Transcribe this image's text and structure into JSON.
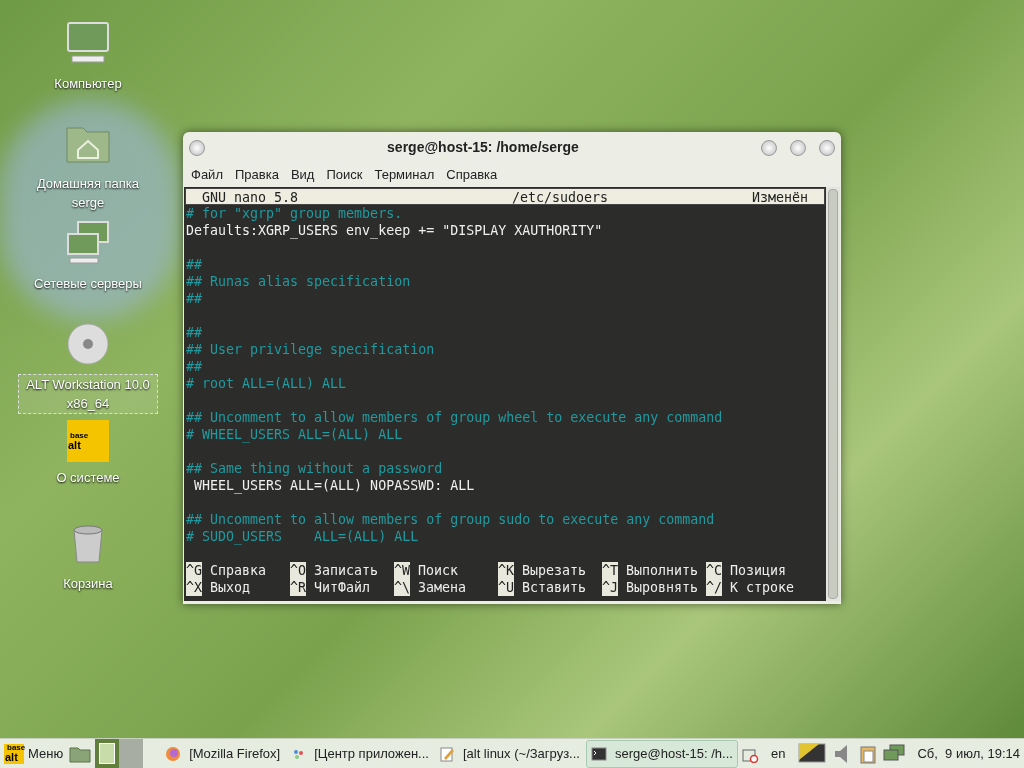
{
  "desktop_icons": [
    {
      "kind": "computer",
      "label": "Компьютер",
      "selected": false
    },
    {
      "kind": "home",
      "label": "Домашняя папка serge",
      "selected": false
    },
    {
      "kind": "network",
      "label": "Сетевые серверы",
      "selected": false
    },
    {
      "kind": "disc",
      "label": "ALT Workstation 10.0 x86_64",
      "selected": true
    },
    {
      "kind": "altlogo",
      "label": "О системе",
      "selected": false,
      "logo": {
        "top": "base",
        "bottom": "alt"
      }
    },
    {
      "kind": "trash",
      "label": "Корзина",
      "selected": false
    }
  ],
  "window": {
    "title": "serge@host-15: /home/serge",
    "menu": [
      "Файл",
      "Правка",
      "Вид",
      "Поиск",
      "Терминал",
      "Справка"
    ]
  },
  "nano": {
    "header": {
      "version": "GNU nano 5.8",
      "file": "/etc/sudoers",
      "status": "Изменён"
    },
    "lines": [
      {
        "kind": "comment",
        "text": "# for \"xgrp\" group members."
      },
      {
        "kind": "code",
        "text": "Defaults:XGRP_USERS env_keep += \"DISPLAY XAUTHORITY\""
      },
      {
        "kind": "blank"
      },
      {
        "kind": "comment",
        "text": "##"
      },
      {
        "kind": "comment",
        "text": "## Runas alias specification"
      },
      {
        "kind": "comment",
        "text": "##"
      },
      {
        "kind": "blank"
      },
      {
        "kind": "comment",
        "text": "##"
      },
      {
        "kind": "comment",
        "text": "## User privilege specification"
      },
      {
        "kind": "comment",
        "text": "##"
      },
      {
        "kind": "comment",
        "text": "# root ALL=(ALL) ALL"
      },
      {
        "kind": "blank"
      },
      {
        "kind": "comment",
        "text": "## Uncomment to allow members of group wheel to execute any command"
      },
      {
        "kind": "comment",
        "text": "# WHEEL_USERS ALL=(ALL) ALL"
      },
      {
        "kind": "blank"
      },
      {
        "kind": "comment",
        "text": "## Same thing without a password"
      },
      {
        "kind": "code",
        "text": " WHEEL_USERS ALL=(ALL) NOPASSWD: ALL"
      },
      {
        "kind": "blank"
      },
      {
        "kind": "comment",
        "text": "## Uncomment to allow members of group sudo to execute any command"
      },
      {
        "kind": "comment",
        "text": "# SUDO_USERS    ALL=(ALL) ALL"
      },
      {
        "kind": "blank"
      }
    ],
    "shortcuts": [
      [
        {
          "key": "^G",
          "label": "Справка"
        },
        {
          "key": "^O",
          "label": "Записать"
        },
        {
          "key": "^W",
          "label": "Поиск"
        },
        {
          "key": "^K",
          "label": "Вырезать"
        },
        {
          "key": "^T",
          "label": "Выполнить"
        },
        {
          "key": "^C",
          "label": "Позиция"
        }
      ],
      [
        {
          "key": "^X",
          "label": "Выход"
        },
        {
          "key": "^R",
          "label": "ЧитФайл"
        },
        {
          "key": "^\\",
          "label": "Замена"
        },
        {
          "key": "^U",
          "label": "Вставить"
        },
        {
          "key": "^J",
          "label": "Выровнять"
        },
        {
          "key": "^/",
          "label": "К строке"
        }
      ]
    ]
  },
  "taskbar": {
    "menu_label": "Меню",
    "menu_logo": {
      "top": "base",
      "bottom": "alt"
    },
    "workspaces": [
      {
        "selected": true
      },
      {
        "selected": false
      }
    ],
    "tasks": [
      {
        "kind": "firefox",
        "label": "[Mozilla Firefox]",
        "selected": false
      },
      {
        "kind": "apps",
        "label": "[Центр приложен...",
        "selected": false
      },
      {
        "kind": "editor",
        "label": "[alt linux (~/Загруз...",
        "selected": false
      },
      {
        "kind": "terminal",
        "label": "serge@host-15: /h...",
        "selected": true
      }
    ],
    "keyboard_layout": "en",
    "clock": "Сб,  9 июл, 19:14"
  }
}
